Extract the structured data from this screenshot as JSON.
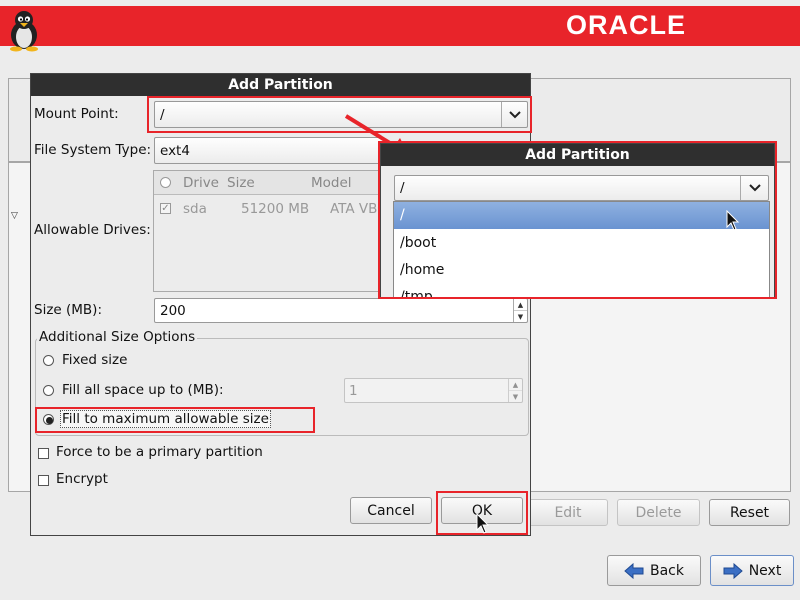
{
  "header": {
    "logo_text": "ORACLE",
    "accent": "#e8242a"
  },
  "add_partition_dialog": {
    "title": "Add Partition",
    "mount_point_label": "Mount Point:",
    "mount_point_value": "/",
    "fs_type_label": "File System Type:",
    "fs_type_value": "ext4",
    "drives_label": "Allowable Drives:",
    "drives_columns": [
      "Drive",
      "Size",
      "Model"
    ],
    "drives_rows": [
      {
        "drive": "sda",
        "size": "51200 MB",
        "model": "ATA VBO"
      }
    ],
    "size_label": "Size (MB):",
    "size_value": "200",
    "size_options_title": "Additional Size Options",
    "fixed_size": "Fixed size",
    "fill_up_to": "Fill all space up to (MB):",
    "fill_up_to_value": "1",
    "fill_max": "Fill to maximum allowable size",
    "primary": "Force to be a primary partition",
    "encrypt": "Encrypt",
    "cancel": "Cancel",
    "ok": "OK"
  },
  "mount_dropdown": {
    "title": "Add Partition",
    "value": "/",
    "options": [
      "/",
      "/boot",
      "/home",
      "/tmp"
    ],
    "selected_index": 0
  },
  "background": {
    "hidden_label_fragment": "e:"
  },
  "bottom_buttons": {
    "edit": "Edit",
    "delete": "Delete",
    "reset": "Reset",
    "back": "Back",
    "next": "Next"
  }
}
